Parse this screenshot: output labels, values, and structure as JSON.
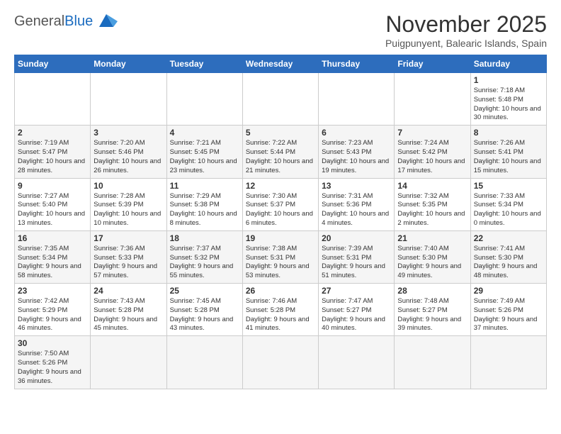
{
  "header": {
    "logo_general": "General",
    "logo_blue": "Blue",
    "month_year": "November 2025",
    "location": "Puigpunyent, Balearic Islands, Spain"
  },
  "days_of_week": [
    "Sunday",
    "Monday",
    "Tuesday",
    "Wednesday",
    "Thursday",
    "Friday",
    "Saturday"
  ],
  "weeks": [
    [
      {
        "day": "",
        "info": ""
      },
      {
        "day": "",
        "info": ""
      },
      {
        "day": "",
        "info": ""
      },
      {
        "day": "",
        "info": ""
      },
      {
        "day": "",
        "info": ""
      },
      {
        "day": "",
        "info": ""
      },
      {
        "day": "1",
        "info": "Sunrise: 7:18 AM\nSunset: 5:48 PM\nDaylight: 10 hours and 30 minutes."
      }
    ],
    [
      {
        "day": "2",
        "info": "Sunrise: 7:19 AM\nSunset: 5:47 PM\nDaylight: 10 hours and 28 minutes."
      },
      {
        "day": "3",
        "info": "Sunrise: 7:20 AM\nSunset: 5:46 PM\nDaylight: 10 hours and 26 minutes."
      },
      {
        "day": "4",
        "info": "Sunrise: 7:21 AM\nSunset: 5:45 PM\nDaylight: 10 hours and 23 minutes."
      },
      {
        "day": "5",
        "info": "Sunrise: 7:22 AM\nSunset: 5:44 PM\nDaylight: 10 hours and 21 minutes."
      },
      {
        "day": "6",
        "info": "Sunrise: 7:23 AM\nSunset: 5:43 PM\nDaylight: 10 hours and 19 minutes."
      },
      {
        "day": "7",
        "info": "Sunrise: 7:24 AM\nSunset: 5:42 PM\nDaylight: 10 hours and 17 minutes."
      },
      {
        "day": "8",
        "info": "Sunrise: 7:26 AM\nSunset: 5:41 PM\nDaylight: 10 hours and 15 minutes."
      }
    ],
    [
      {
        "day": "9",
        "info": "Sunrise: 7:27 AM\nSunset: 5:40 PM\nDaylight: 10 hours and 13 minutes."
      },
      {
        "day": "10",
        "info": "Sunrise: 7:28 AM\nSunset: 5:39 PM\nDaylight: 10 hours and 10 minutes."
      },
      {
        "day": "11",
        "info": "Sunrise: 7:29 AM\nSunset: 5:38 PM\nDaylight: 10 hours and 8 minutes."
      },
      {
        "day": "12",
        "info": "Sunrise: 7:30 AM\nSunset: 5:37 PM\nDaylight: 10 hours and 6 minutes."
      },
      {
        "day": "13",
        "info": "Sunrise: 7:31 AM\nSunset: 5:36 PM\nDaylight: 10 hours and 4 minutes."
      },
      {
        "day": "14",
        "info": "Sunrise: 7:32 AM\nSunset: 5:35 PM\nDaylight: 10 hours and 2 minutes."
      },
      {
        "day": "15",
        "info": "Sunrise: 7:33 AM\nSunset: 5:34 PM\nDaylight: 10 hours and 0 minutes."
      }
    ],
    [
      {
        "day": "16",
        "info": "Sunrise: 7:35 AM\nSunset: 5:34 PM\nDaylight: 9 hours and 58 minutes."
      },
      {
        "day": "17",
        "info": "Sunrise: 7:36 AM\nSunset: 5:33 PM\nDaylight: 9 hours and 57 minutes."
      },
      {
        "day": "18",
        "info": "Sunrise: 7:37 AM\nSunset: 5:32 PM\nDaylight: 9 hours and 55 minutes."
      },
      {
        "day": "19",
        "info": "Sunrise: 7:38 AM\nSunset: 5:31 PM\nDaylight: 9 hours and 53 minutes."
      },
      {
        "day": "20",
        "info": "Sunrise: 7:39 AM\nSunset: 5:31 PM\nDaylight: 9 hours and 51 minutes."
      },
      {
        "day": "21",
        "info": "Sunrise: 7:40 AM\nSunset: 5:30 PM\nDaylight: 9 hours and 49 minutes."
      },
      {
        "day": "22",
        "info": "Sunrise: 7:41 AM\nSunset: 5:30 PM\nDaylight: 9 hours and 48 minutes."
      }
    ],
    [
      {
        "day": "23",
        "info": "Sunrise: 7:42 AM\nSunset: 5:29 PM\nDaylight: 9 hours and 46 minutes."
      },
      {
        "day": "24",
        "info": "Sunrise: 7:43 AM\nSunset: 5:28 PM\nDaylight: 9 hours and 45 minutes."
      },
      {
        "day": "25",
        "info": "Sunrise: 7:45 AM\nSunset: 5:28 PM\nDaylight: 9 hours and 43 minutes."
      },
      {
        "day": "26",
        "info": "Sunrise: 7:46 AM\nSunset: 5:28 PM\nDaylight: 9 hours and 41 minutes."
      },
      {
        "day": "27",
        "info": "Sunrise: 7:47 AM\nSunset: 5:27 PM\nDaylight: 9 hours and 40 minutes."
      },
      {
        "day": "28",
        "info": "Sunrise: 7:48 AM\nSunset: 5:27 PM\nDaylight: 9 hours and 39 minutes."
      },
      {
        "day": "29",
        "info": "Sunrise: 7:49 AM\nSunset: 5:26 PM\nDaylight: 9 hours and 37 minutes."
      }
    ],
    [
      {
        "day": "30",
        "info": "Sunrise: 7:50 AM\nSunset: 5:26 PM\nDaylight: 9 hours and 36 minutes."
      },
      {
        "day": "",
        "info": ""
      },
      {
        "day": "",
        "info": ""
      },
      {
        "day": "",
        "info": ""
      },
      {
        "day": "",
        "info": ""
      },
      {
        "day": "",
        "info": ""
      },
      {
        "day": "",
        "info": ""
      }
    ]
  ]
}
